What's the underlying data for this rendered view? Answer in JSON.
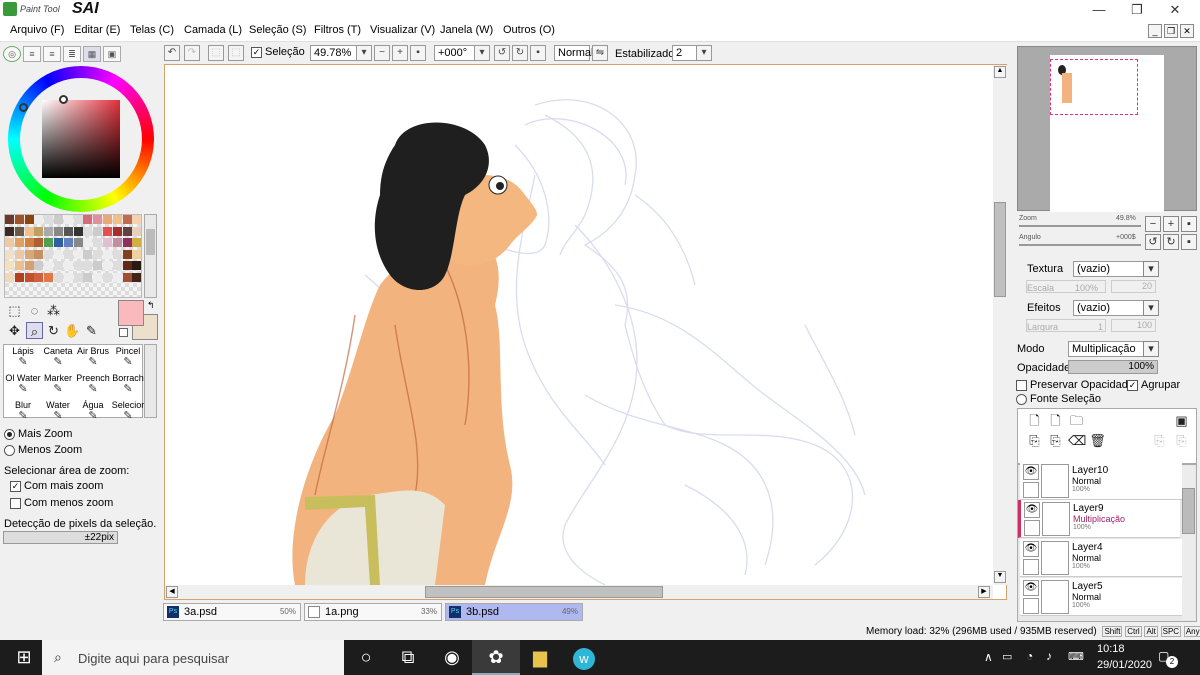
{
  "app": {
    "logo_small": "Paint Tool",
    "logo_big": "SAI",
    "accent": "#3a9a3a"
  },
  "menu": [
    "Arquivo (F)",
    "Editar (E)",
    "Telas (C)",
    "Camada (L)",
    "Seleção (S)",
    "Filtros (T)",
    "Visualizar (V)",
    "Janela (W)",
    "Outros (O)"
  ],
  "window_buttons": {
    "minimize": "—",
    "maximize": "❐",
    "close": "✕"
  },
  "canvas_toolbar": {
    "selection_label": "Seleção",
    "selection_checked": true,
    "zoom": "49.78%",
    "angle": "+000°",
    "blend": "Normal",
    "stabilizer_label": "Estabilizador",
    "stabilizer_value": "2"
  },
  "tools": {
    "brushes": [
      "Lápis",
      "Caneta",
      "Air Brus",
      "Pincel",
      "Ol Water",
      "Marker",
      "Preench",
      "Borrach",
      "Blur",
      "Water",
      "Água",
      "Selecior"
    ],
    "zoom_options": {
      "more": "Mais Zoom",
      "less": "Menos Zoom",
      "selected": "more"
    },
    "zoom_area_label": "Selecionar área de zoom:",
    "with_more_zoom": "Com mais zoom",
    "with_less_zoom": "Com menos zoom",
    "with_more_checked": true,
    "with_less_checked": false,
    "pixel_detect_label": "Detecção de pixels da seleção.",
    "pixel_detect_value": "±22pix"
  },
  "colors": {
    "primary": "#f9b9bd",
    "secondary": "#ece0cc"
  },
  "navigator": {
    "zoom_label": "Zoom",
    "zoom_value": "49.8%",
    "angle_label": "Angulo",
    "angle_value": "+000$"
  },
  "properties": {
    "texture_label": "Textura",
    "texture_value": "(vazio)",
    "scale_label": "Escala",
    "scale_value": "100%",
    "scale_num": "20",
    "effects_label": "Efeitos",
    "effects_value": "(vazio)",
    "width_label": "Largura",
    "width_value": "1",
    "width_num": "100",
    "mode_label": "Modo",
    "mode_value": "Multiplicação",
    "opacity_label": "Opacidade",
    "opacity_value": "100%",
    "preserve_label": "Preservar Opacidade",
    "group_label": "Agrupar",
    "preserve_checked": false,
    "group_checked": true,
    "source_label": "Fonte Seleção"
  },
  "layers": [
    {
      "name": "Layer10",
      "mode": "Normal",
      "opacity": "100%",
      "selected": false
    },
    {
      "name": "Layer9",
      "mode": "Multiplicação",
      "opacity": "100%",
      "selected": true
    },
    {
      "name": "Layer4",
      "mode": "Normal",
      "opacity": "100%",
      "selected": false
    },
    {
      "name": "Layer5",
      "mode": "Normal",
      "opacity": "100%",
      "selected": false
    }
  ],
  "documents": [
    {
      "name": "3a.psd",
      "pct": "50%",
      "active": false
    },
    {
      "name": "1a.png",
      "pct": "33%",
      "active": false
    },
    {
      "name": "3b.psd",
      "pct": "49%",
      "active": true
    }
  ],
  "status": {
    "memory": "Memory load: 32% (296MB used / 935MB reserved)",
    "keys": [
      "Shift",
      "Ctrl",
      "Alt",
      "SPC"
    ],
    "any": "Any"
  },
  "taskbar": {
    "search_placeholder": "Digite aqui para pesquisar",
    "time": "10:18",
    "date": "29/01/2020",
    "notif_count": "2"
  }
}
